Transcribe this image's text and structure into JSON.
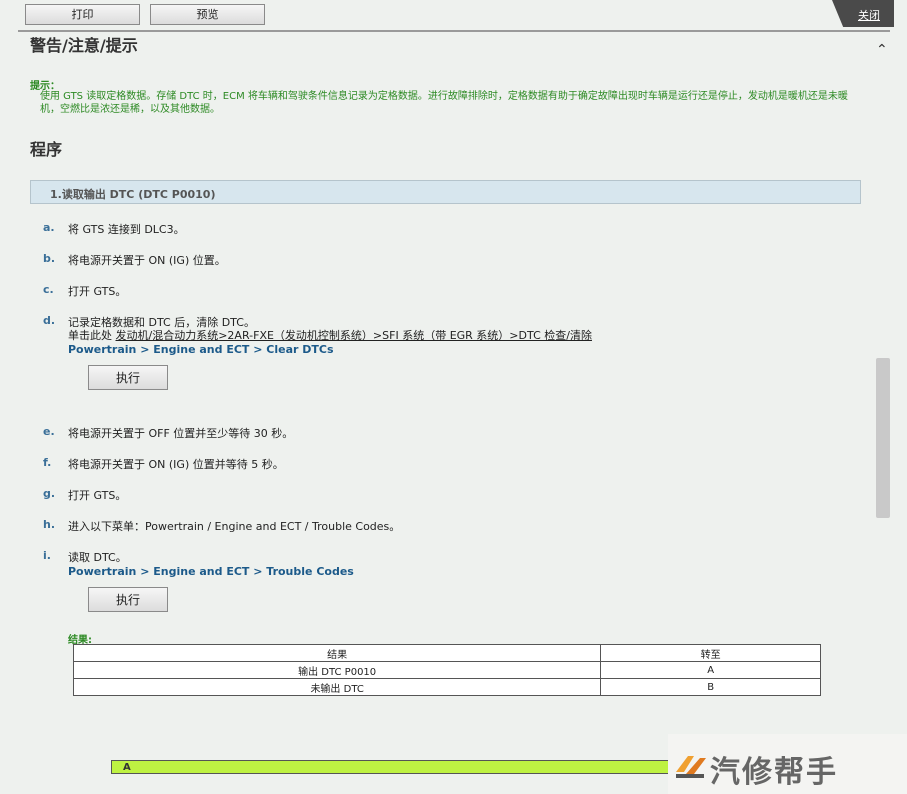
{
  "toolbar": {
    "print_label": "打印",
    "preview_label": "预览",
    "close_label": "关闭"
  },
  "warning_heading": "警告/注意/提示",
  "hint": {
    "label": "提示：",
    "text": "使用 GTS 读取定格数据。存储 DTC 时，ECM 将车辆和驾驶条件信息记录为定格数据。进行故障排除时，定格数据有助于确定故障出现时车辆是运行还是停止，发动机是暖机还是未暖机，空燃比是浓还是稀，以及其他数据。"
  },
  "procedure_heading": "程序",
  "step": {
    "title": "1.读取输出 DTC (DTC P0010)"
  },
  "substeps": {
    "a": {
      "letter": "a.",
      "text": "将 GTS 连接到 DLC3。"
    },
    "b": {
      "letter": "b.",
      "text": "将电源开关置于 ON (IG) 位置。"
    },
    "c": {
      "letter": "c.",
      "text": "打开 GTS。"
    },
    "d": {
      "letter": "d.",
      "text": "记录定格数据和 DTC 后，清除 DTC。",
      "link_prefix": "单击此处 ",
      "link_text": "发动机/混合动力系统>2AR-FXE（发动机控制系统）>SFI 系统（带 EGR 系统）>DTC 检查/清除",
      "path": "Powertrain > Engine and ECT > Clear DTCs",
      "exec_label": "执行"
    },
    "e": {
      "letter": "e.",
      "text": "将电源开关置于 OFF 位置并至少等待 30 秒。"
    },
    "f": {
      "letter": "f.",
      "text": "将电源开关置于 ON (IG) 位置并等待 5 秒。"
    },
    "g": {
      "letter": "g.",
      "text": "打开 GTS。"
    },
    "h": {
      "letter": "h.",
      "text": "进入以下菜单：Powertrain / Engine and ECT / Trouble Codes。"
    },
    "i": {
      "letter": "i.",
      "text": "读取 DTC。",
      "path": "Powertrain > Engine and ECT > Trouble Codes",
      "exec_label": "执行"
    }
  },
  "results": {
    "label": "结果:",
    "headers": [
      "结果",
      "转至"
    ],
    "rows": [
      [
        "输出 DTC P0010",
        "A"
      ],
      [
        "未输出 DTC",
        "B"
      ]
    ]
  },
  "next_bar": {
    "label": "A"
  },
  "watermark": {
    "text": "汽修帮手"
  },
  "colors": {
    "accent_green": "#2d8a24",
    "link_blue": "#1c5a8a",
    "step_bar": "#d7e6ee",
    "result_bar": "#bef242"
  }
}
